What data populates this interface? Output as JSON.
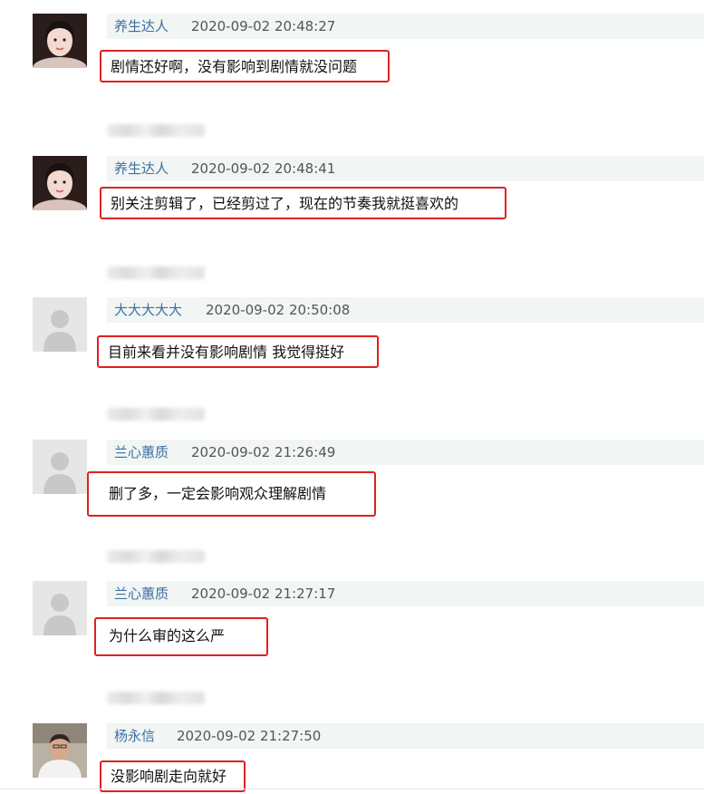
{
  "colors": {
    "username": "#3e6fa0",
    "timestamp": "#555555",
    "header_bg": "#f1f5f4",
    "highlight_border": "#e02020"
  },
  "comments": [
    {
      "user": "养生达人",
      "time": "2020-09-02 20:48:27",
      "text": "剧情还好啊，没有影响到剧情就没问题",
      "avatar": "girl-photo-avatar"
    },
    {
      "user": "养生达人",
      "time": "2020-09-02 20:48:41",
      "text": "别关注剪辑了，已经剪过了，现在的节奏我就挺喜欢的",
      "avatar": "girl-photo-avatar"
    },
    {
      "user": "大大大大大",
      "time": "2020-09-02 20:50:08",
      "text": "目前来看并没有影响剧情 我觉得挺好",
      "avatar": "default-user-avatar"
    },
    {
      "user": "兰心蕙质",
      "time": "2020-09-02 21:26:49",
      "text": "删了多，一定会影响观众理解剧情",
      "avatar": "default-user-avatar"
    },
    {
      "user": "兰心蕙质",
      "time": "2020-09-02 21:27:17",
      "text": "为什么审的这么严",
      "avatar": "default-user-avatar"
    },
    {
      "user": "杨永信",
      "time": "2020-09-02 21:27:50",
      "text": "没影响剧走向就好",
      "avatar": "man-photo-avatar"
    }
  ]
}
